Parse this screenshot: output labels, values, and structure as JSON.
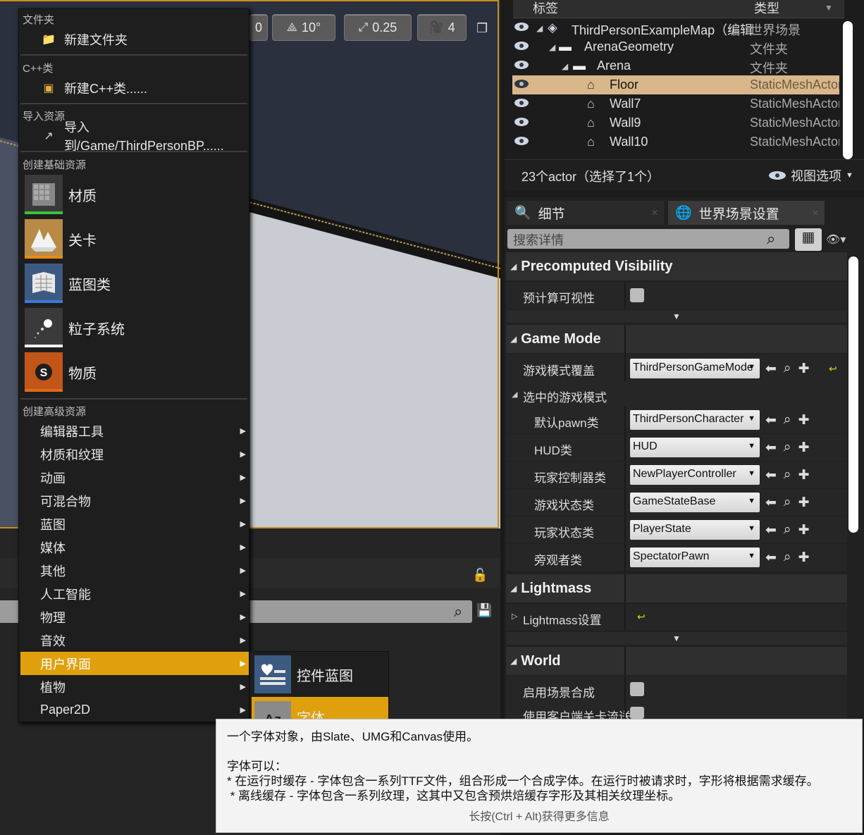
{
  "viewport_toolbar": {
    "b0": "0",
    "snap_angle": "10°",
    "scale": "0.25",
    "cam_speed": "4"
  },
  "context_menu": {
    "folder_header": "文件夹",
    "new_folder": "新建文件夹",
    "cpp_header": "C++类",
    "new_cpp": "新建C++类......",
    "import_header": "导入资源",
    "import_to": "导入到/Game/ThirdPersonBP......",
    "basic_header": "创建基础资源",
    "basic_items": [
      "材质",
      "关卡",
      "蓝图类",
      "粒子系统",
      "物质"
    ],
    "advanced_header": "创建高级资源",
    "advanced_items": [
      "编辑器工具",
      "材质和纹理",
      "动画",
      "可混合物",
      "蓝图",
      "媒体",
      "其他",
      "人工智能",
      "物理",
      "音效",
      "用户界面",
      "植物",
      "Paper2D"
    ]
  },
  "submenu": {
    "items": [
      "控件蓝图",
      "字体"
    ]
  },
  "tooltip": {
    "line1": "一个字体对象，由Slate、UMG和Canvas使用。",
    "line2": "字体可以：",
    "line3": "* 在运行时缓存 - 字体包含一系列TTF文件，组合形成一个合成字体。在运行时被请求时，字形将根据需求缓存。",
    "line4": " * 离线缓存 - 字体包含一系列纹理，这其中又包含预烘焙缓存字形及其相关纹理坐标。",
    "hint": "长按(Ctrl + Alt)获得更多信息"
  },
  "outliner": {
    "col_label": "标签",
    "col_type": "类型",
    "rows": [
      {
        "label": "ThirdPersonExampleMap（编辑",
        "type": "世界场景"
      },
      {
        "label": "ArenaGeometry",
        "type": "文件夹"
      },
      {
        "label": "Arena",
        "type": "文件夹"
      },
      {
        "label": "Floor",
        "type": "StaticMeshActor"
      },
      {
        "label": "Wall7",
        "type": "StaticMeshActor"
      },
      {
        "label": "Wall9",
        "type": "StaticMeshActor"
      },
      {
        "label": "Wall10",
        "type": "StaticMeshActor"
      }
    ],
    "count": "23个actor（选择了1个）",
    "view_options": "视图选项"
  },
  "details": {
    "tab_details": "细节",
    "tab_world": "世界场景设置",
    "search_placeholder": "搜索详情",
    "cat_precomputed": "Precomputed Visibility",
    "prop_precomputed": "预计算可视性",
    "cat_gamemode": "Game Mode",
    "prop_gm_override": "游戏模式覆盖",
    "val_gm_override": "ThirdPersonGameMode",
    "prop_selected_gm": "选中的游戏模式",
    "props": [
      {
        "label": "默认pawn类",
        "value": "ThirdPersonCharacter"
      },
      {
        "label": "HUD类",
        "value": "HUD"
      },
      {
        "label": "玩家控制器类",
        "value": "NewPlayerController"
      },
      {
        "label": "游戏状态类",
        "value": "GameStateBase"
      },
      {
        "label": "玩家状态类",
        "value": "PlayerState"
      },
      {
        "label": "旁观者类",
        "value": "SpectatorPawn"
      }
    ],
    "cat_lightmass": "Lightmass",
    "prop_lightmass": "Lightmass设置",
    "cat_world": "World",
    "prop_enable_composition": "启用场景合成",
    "prop_client_streaming": "使用客户端关卡流送"
  },
  "colors": {
    "accent": "#e0a00e",
    "selection": "#d9b78b",
    "viewport_border": "#c98f1a"
  }
}
